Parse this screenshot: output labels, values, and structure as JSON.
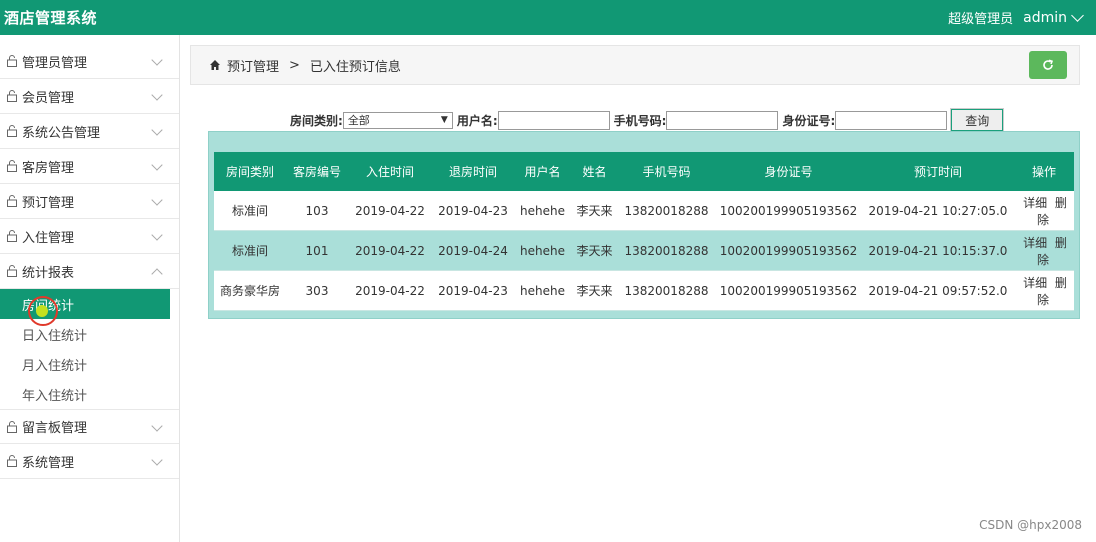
{
  "app": {
    "title": "酒店管理系统"
  },
  "header": {
    "role": "超级管理员",
    "username": "admin"
  },
  "sidebar": {
    "items": [
      {
        "label": "管理员管理",
        "expanded": false
      },
      {
        "label": "会员管理",
        "expanded": false
      },
      {
        "label": "系统公告管理",
        "expanded": false
      },
      {
        "label": "客房管理",
        "expanded": false
      },
      {
        "label": "预订管理",
        "expanded": false
      },
      {
        "label": "入住管理",
        "expanded": false
      },
      {
        "label": "统计报表",
        "expanded": true
      },
      {
        "label": "留言板管理",
        "expanded": false
      },
      {
        "label": "系统管理",
        "expanded": false
      }
    ],
    "subitems": [
      {
        "label": "房间统计",
        "active": true
      },
      {
        "label": "日入住统计",
        "active": false
      },
      {
        "label": "月入住统计",
        "active": false
      },
      {
        "label": "年入住统计",
        "active": false
      }
    ]
  },
  "breadcrumb": {
    "parent": "预订管理",
    "separator": ">",
    "current": "已入住预订信息"
  },
  "search": {
    "room_type_label": "房间类别:",
    "room_type_value": "全部",
    "username_label": "用户名:",
    "phone_label": "手机号码:",
    "idcard_label": "身份证号:",
    "query_label": "查询"
  },
  "table": {
    "headers": [
      "房间类别",
      "客房编号",
      "入住时间",
      "退房时间",
      "用户名",
      "姓名",
      "手机号码",
      "身份证号",
      "预订时间",
      "操作"
    ],
    "rows": [
      [
        "标准间",
        "103",
        "2019-04-22",
        "2019-04-23",
        "hehehe",
        "李天来",
        "13820018288",
        "100200199905193562",
        "2019-04-21 10:27:05.0"
      ],
      [
        "标准间",
        "101",
        "2019-04-22",
        "2019-04-24",
        "hehehe",
        "李天来",
        "13820018288",
        "100200199905193562",
        "2019-04-21 10:15:37.0"
      ],
      [
        "商务豪华房",
        "303",
        "2019-04-22",
        "2019-04-23",
        "hehehe",
        "李天来",
        "13820018288",
        "100200199905193562",
        "2019-04-21 09:57:52.0"
      ]
    ],
    "actions": [
      "详细",
      "删除"
    ]
  },
  "watermark": "CSDN @hpx2008",
  "colors": {
    "primary": "#119874",
    "table_bg": "#aadfd9",
    "refresh": "#5cb85c"
  }
}
